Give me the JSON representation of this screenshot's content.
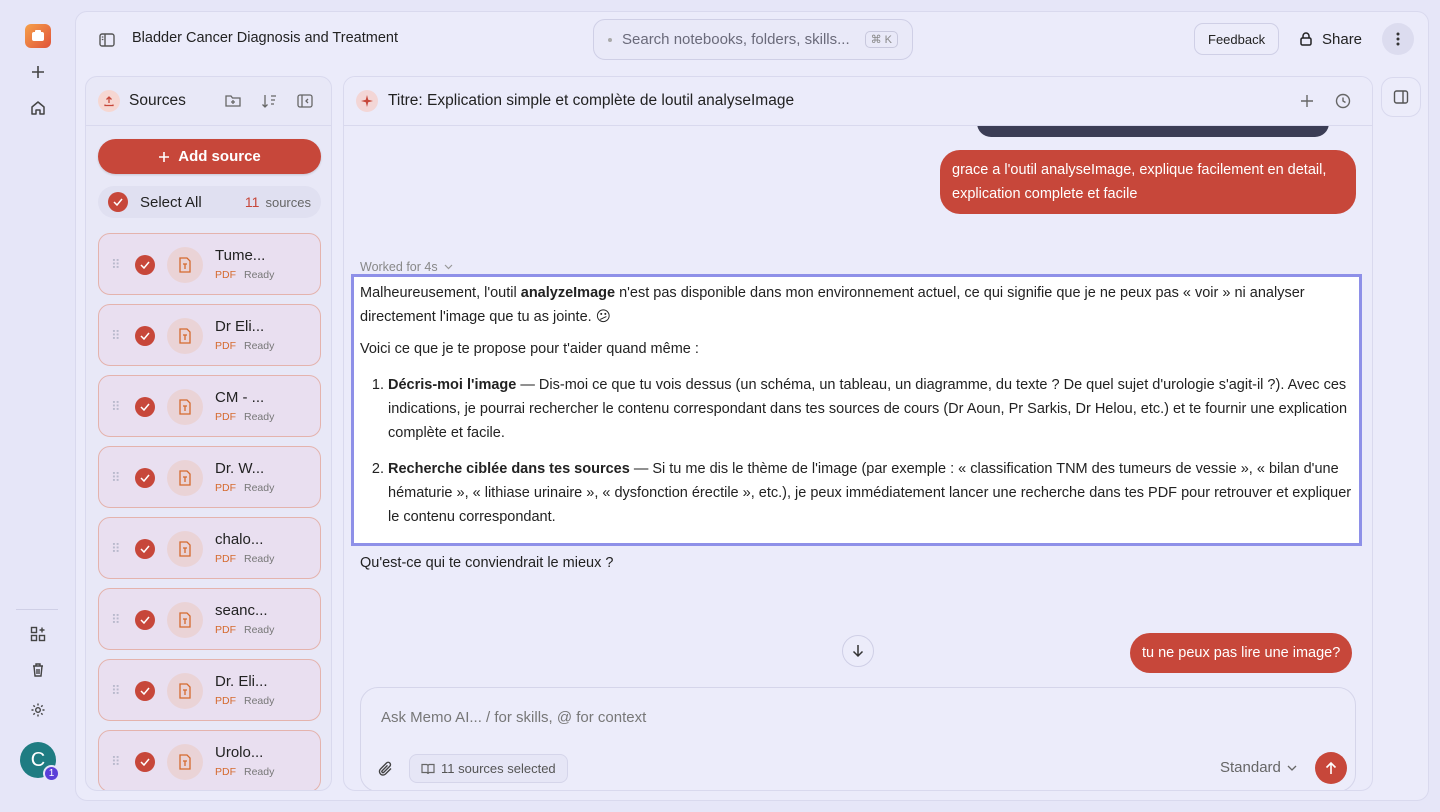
{
  "rail": {
    "items": [
      "app-logo",
      "plus-icon",
      "home-icon",
      "plugins-icon",
      "trash-icon",
      "gear-icon"
    ],
    "avatar_letter": "C",
    "avatar_badge": "1"
  },
  "topbar": {
    "title": "Bladder Cancer Diagnosis and Treatment",
    "search_placeholder": "Search notebooks, folders, skills...",
    "search_shortcut": "⌘ K",
    "feedback_label": "Feedback",
    "share_label": "Share"
  },
  "sources": {
    "title": "Sources",
    "add_label": "Add source",
    "select_all_label": "Select All",
    "count": "11",
    "count_label": "sources",
    "items": [
      {
        "name": "Tume...",
        "type": "PDF",
        "status": "Ready"
      },
      {
        "name": "Dr Eli...",
        "type": "PDF",
        "status": "Ready"
      },
      {
        "name": "CM - ...",
        "type": "PDF",
        "status": "Ready"
      },
      {
        "name": "Dr. W...",
        "type": "PDF",
        "status": "Ready"
      },
      {
        "name": "chalo...",
        "type": "PDF",
        "status": "Ready"
      },
      {
        "name": "seanc...",
        "type": "PDF",
        "status": "Ready"
      },
      {
        "name": "Dr. Eli...",
        "type": "PDF",
        "status": "Ready"
      },
      {
        "name": "Urolo...",
        "type": "PDF",
        "status": "Ready"
      }
    ]
  },
  "chat": {
    "title": "Titre: Explication simple et complète de loutil analyseImage",
    "user_msg_1": "grace a l'outil analyseImage, explique facilement en detail, explication complete et facile",
    "worked_label": "Worked for 4s",
    "answer": {
      "p1_pre": "Malheureusement, l'outil ",
      "p1_bold": "analyzeImage",
      "p1_post": " n'est pas disponible dans mon environnement actuel, ce qui signifie que je ne peux pas « voir » ni analyser directement l'image que tu as jointe. 😕",
      "p2": "Voici ce que je te propose pour t'aider quand même :",
      "items": [
        {
          "bold": "Décris-moi l'image",
          "text": " — Dis-moi ce que tu vois dessus (un schéma, un tableau, un diagramme, du texte ? De quel sujet d'urologie s'agit-il ?). Avec ces indications, je pourrai rechercher le contenu correspondant dans tes sources de cours (Dr Aoun, Pr Sarkis, Dr Helou, etc.) et te fournir une explication complète et facile."
        },
        {
          "bold": "Recherche ciblée dans tes sources",
          "text": " — Si tu me dis le thème de l'image (par exemple : « classification TNM des tumeurs de vessie », « bilan d'une hématurie », « lithiase urinaire », « dysfonction érectile », etc.), je peux immédiatement lancer une recherche dans tes PDF pour retrouver et expliquer le contenu correspondant."
        }
      ]
    },
    "after_text": "Qu'est-ce qui te conviendrait le mieux ?",
    "user_msg_2": "tu ne peux pas lire une image?",
    "composer": {
      "placeholder": "Ask Memo AI... / for skills, @ for context",
      "sources_chip": "11 sources selected",
      "mode": "Standard"
    }
  },
  "colors": {
    "accent": "#c7473a",
    "highlight_border": "#8e90e8",
    "pdf_label": "#d56a2e"
  }
}
